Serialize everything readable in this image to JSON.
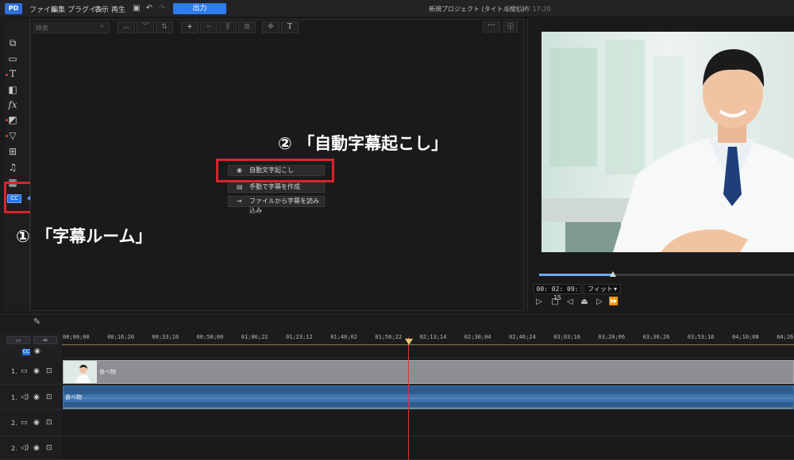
{
  "menu": {
    "logo": "PD",
    "items": [
      "ファイル",
      "編集",
      "プラグイン",
      "表示",
      "再生"
    ],
    "export_label": "出力",
    "project_title": "新規プロジェクト (タイトルなし)*",
    "save_status": "自動保存 17:20"
  },
  "library": {
    "search_placeholder": "検索",
    "text_tool_label": "T",
    "more_label": "···",
    "info_label": "ⓘ"
  },
  "subtitle_menu": {
    "auto": "自動文字起こし",
    "manual": "手動で字幕を作成",
    "import": "ファイルから字幕を読み込み"
  },
  "annotations": {
    "step1": "① 「字幕ルーム」",
    "step2": "② 「自動字幕起こし」"
  },
  "preview": {
    "timecode": "00: 02: 09: 15",
    "fit": "フィット",
    "seek_progress": 0.29
  },
  "timeline": {
    "ruler_ticks": [
      "00;00;00",
      "00;16;20",
      "00;33;10",
      "00;50;00",
      "01;06;22",
      "01;23;12",
      "01;40;02",
      "01;56;22",
      "02;13;14",
      "02;30;04",
      "02;46;24",
      "03;03;16",
      "03;20;06",
      "03;36;26",
      "03;53;16",
      "04;10;08",
      "04;26;"
    ],
    "tracks": [
      {
        "num": "1.",
        "type": "video"
      },
      {
        "num": "1.",
        "type": "audio"
      },
      {
        "num": "2.",
        "type": "video"
      },
      {
        "num": "2.",
        "type": "audio"
      }
    ],
    "video_clip_label": "食べ物",
    "audio_clip_label": "食べ物",
    "cc_badge": "CC"
  },
  "colors": {
    "accent": "#2e7bf0",
    "highlight": "#d9232e",
    "audio_clip": "#2d5d8e",
    "video_clip": "#8e8e92"
  },
  "icons": {
    "rail": [
      "media-room-icon",
      "effects-icon",
      "title-icon",
      "transition-icon",
      "fx-icon",
      "pip-icon",
      "particle-icon",
      "template-icon",
      "voice-icon",
      "chapter-icon",
      "subtitle-cc-icon"
    ]
  }
}
